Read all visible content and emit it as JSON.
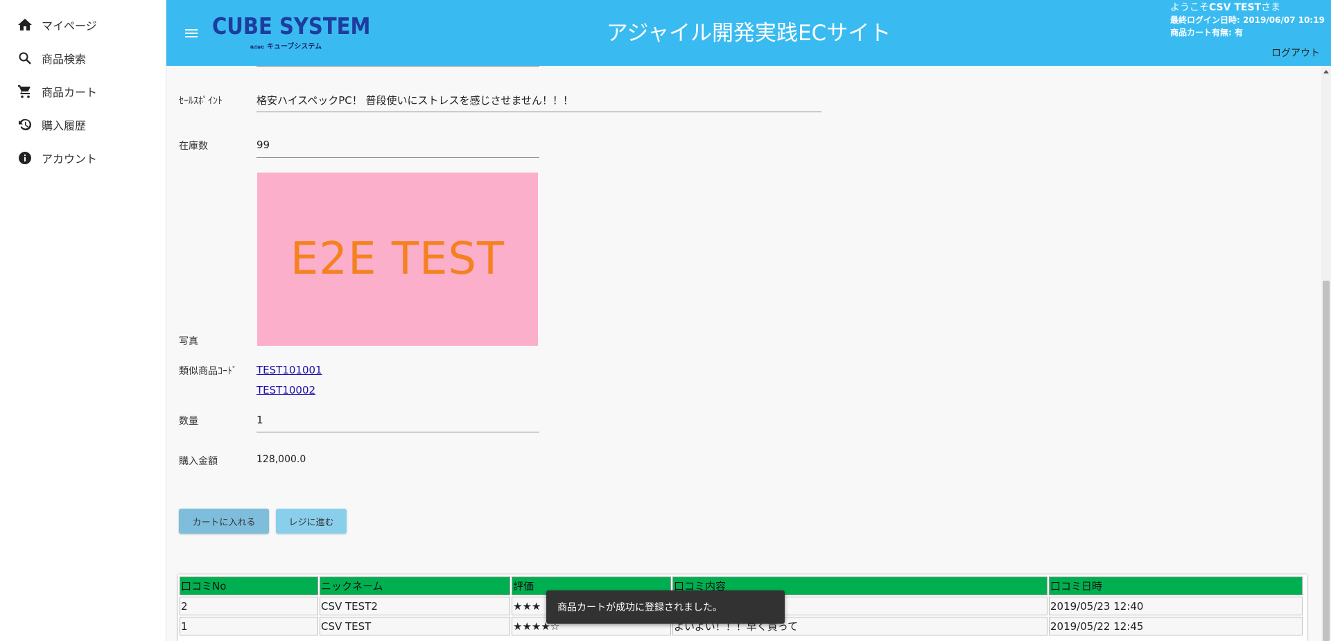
{
  "sidebar": {
    "items": [
      {
        "label": "マイページ",
        "icon": "home-icon"
      },
      {
        "label": "商品検索",
        "icon": "search-icon"
      },
      {
        "label": "商品カート",
        "icon": "cart-icon"
      },
      {
        "label": "購入履歴",
        "icon": "history-icon"
      },
      {
        "label": "アカウント",
        "icon": "info-icon"
      }
    ]
  },
  "header": {
    "logo_main": "CUBE SYSTEM",
    "logo_sub_small": "株式会社",
    "logo_sub": "キューブシステム",
    "title": "アジャイル開発実践ECサイト",
    "welcome_prefix": "ようこそ",
    "welcome_name": "CSV TEST",
    "welcome_suffix": "さま",
    "last_login": "最終ログイン日時: 2019/06/07 10:19",
    "cart_status": "商品カート有無: 有",
    "logout": "ログアウト",
    "colors": {
      "bar": "#39bbf1",
      "logo": "#1e3c9e"
    }
  },
  "product": {
    "sales_point_label": "ｾｰﾙｽﾎﾟｲﾝﾄ",
    "sales_point": "格安ハイスペックPC！ 普段使いにストレスを感じさせません！！！",
    "stock_label": "在庫数",
    "stock": "99",
    "photo_label": "写真",
    "photo_text": "E2E TEST",
    "similar_label": "類似商品ｺｰﾄﾞ",
    "similar_codes": [
      "TEST101001",
      "TEST10002"
    ],
    "quantity_label": "数量",
    "quantity": "1",
    "amount_label": "購入金額",
    "amount": "128,000.0"
  },
  "buttons": {
    "add_to_cart": "カートに入れる",
    "checkout": "レジに進む"
  },
  "reviews": {
    "headers": [
      "口コミNo",
      "ニックネーム",
      "評価",
      "口コミ内容",
      "口コミ日時"
    ],
    "rows": [
      {
        "no": "2",
        "nickname": "CSV TEST2",
        "rating": "★★★",
        "content": "",
        "date": "2019/05/23 12:40"
      },
      {
        "no": "1",
        "nickname": "CSV TEST",
        "rating": "★★★★☆",
        "content": "よいよい！！！早く買って",
        "date": "2019/05/22 12:45"
      }
    ],
    "header_color": "#00b050"
  },
  "toast": {
    "message": "商品カートが成功に登録されました。"
  }
}
